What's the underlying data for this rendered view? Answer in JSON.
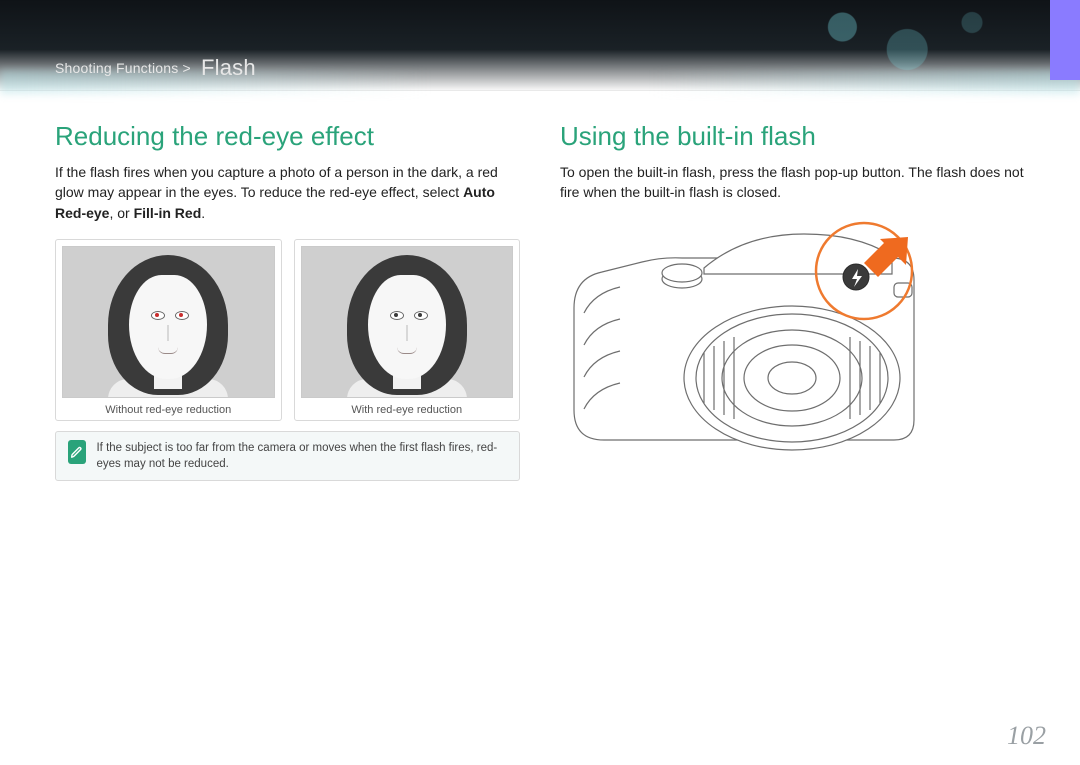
{
  "header": {
    "breadcrumb_prefix": "Shooting Functions >",
    "breadcrumb_current": "Flash"
  },
  "left": {
    "heading": "Reducing the red-eye effect",
    "body_pre": "If the flash fires when you capture a photo of a person in the dark, a red glow may appear in the eyes. To reduce the red-eye effect, select ",
    "body_bold1": "Auto Red-eye",
    "body_mid": ", or ",
    "body_bold2": "Fill-in Red",
    "body_post": ".",
    "captions": {
      "without": "Without red-eye reduction",
      "with": "With red-eye reduction"
    },
    "note": "If the subject is too far from the camera or moves when the first flash fires, red-eyes may not be reduced."
  },
  "right": {
    "heading": "Using the built-in flash",
    "body": "To open the built-in flash, press the flash pop-up button. The flash does not fire when the built-in flash is closed."
  },
  "page_number": "102"
}
